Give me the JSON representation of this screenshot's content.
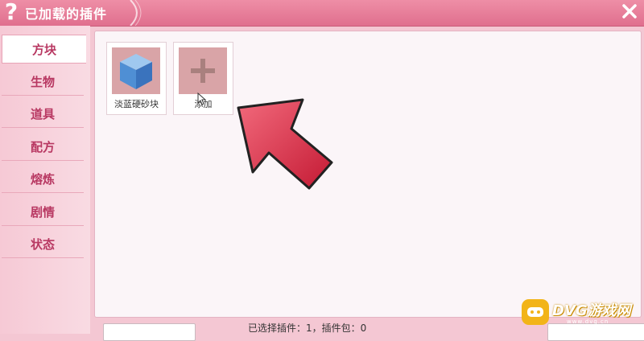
{
  "window": {
    "title": "已加载的插件",
    "help_icon": "question-mark-icon",
    "close_icon": "close-icon"
  },
  "sidebar": {
    "items": [
      {
        "label": "方块",
        "active": true
      },
      {
        "label": "生物",
        "active": false
      },
      {
        "label": "道具",
        "active": false
      },
      {
        "label": "配方",
        "active": false
      },
      {
        "label": "熔炼",
        "active": false
      },
      {
        "label": "剧情",
        "active": false
      },
      {
        "label": "状态",
        "active": false
      }
    ]
  },
  "plugins": [
    {
      "label": "淡蓝硬砂块",
      "icon": "blue-cube-icon"
    },
    {
      "label": "添加",
      "icon": "plus-icon"
    }
  ],
  "footer": {
    "status": "已选择插件：1，插件包：0"
  },
  "colors": {
    "titlebar": "#e06f8e",
    "sidebar_text": "#b83862",
    "arrow": "#e8364f"
  },
  "watermark": {
    "text": "DVG游戏网",
    "sub": "www.dvg.cn"
  }
}
